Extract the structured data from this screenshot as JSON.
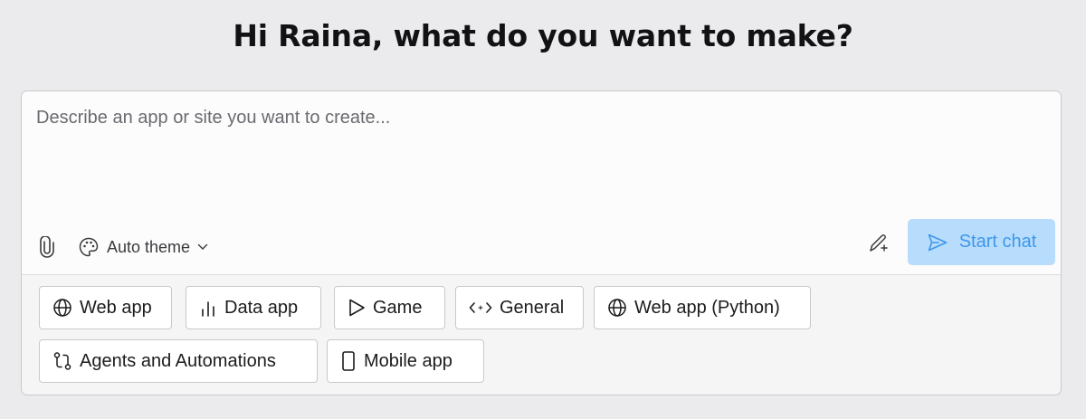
{
  "header": {
    "greeting": "Hi Raina, what do you want to make?"
  },
  "composer": {
    "placeholder": "Describe an app or site you want to create...",
    "value": "",
    "attach_icon": "paperclip-icon",
    "theme": {
      "label": "Auto theme",
      "icon": "palette-icon",
      "caret_icon": "chevron-down-icon"
    },
    "improve_prompt_icon": "pen-sparkle-icon",
    "start_chat": {
      "label": "Start chat",
      "icon": "send-icon",
      "enabled": false
    },
    "colors": {
      "start_chat_bg": "#b8dcfb",
      "start_chat_text": "#3d97ec"
    }
  },
  "templates": [
    {
      "label": "Web app",
      "icon": "globe-icon"
    },
    {
      "label": "Data app",
      "icon": "bar-chart-icon"
    },
    {
      "label": "Game",
      "icon": "play-icon"
    },
    {
      "label": "General",
      "icon": "code-sparkle-icon"
    },
    {
      "label": "Web app (Python)",
      "icon": "globe-icon"
    },
    {
      "label": "Agents and Automations",
      "icon": "workflow-icon"
    },
    {
      "label": "Mobile app",
      "icon": "phone-icon"
    }
  ]
}
